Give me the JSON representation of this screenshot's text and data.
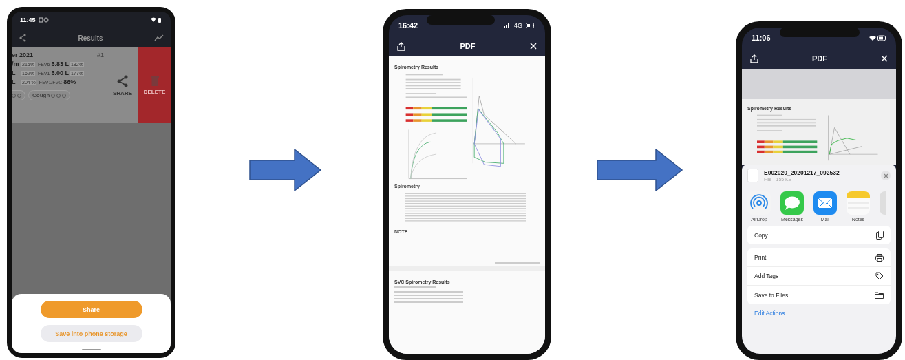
{
  "results_screen": {
    "status_time": "11:45",
    "title": "Results",
    "card": {
      "date": "er 2021",
      "number": "#1",
      "rows": [
        {
          "left_value": "/m",
          "left_percent": "215%",
          "label": "FEV6",
          "value": "5.83 L",
          "percent": "182%"
        },
        {
          "left_value": "L",
          "left_percent": "162%",
          "label": "FEV1",
          "value": "5.00 L",
          "percent": "177%"
        },
        {
          "left_value": "L",
          "left_percent": "204 %",
          "label": "FEV1/FVC",
          "value": "86%"
        }
      ],
      "chips": [
        {
          "kind": "partial"
        },
        {
          "kind": "full",
          "label": "Cough"
        }
      ]
    },
    "swipe_actions": [
      {
        "kind": "share",
        "label": "SHARE"
      },
      {
        "kind": "delete",
        "label": "DELETE"
      }
    ],
    "sheet_buttons": [
      {
        "kind": "primary",
        "label": "Share"
      },
      {
        "kind": "secondary",
        "label": "Save into phone storage"
      }
    ]
  },
  "pdf_screen": {
    "status_time": "16:42",
    "network": "4G",
    "title": "PDF",
    "report_title": "Spirometry Results",
    "section": "Spirometry",
    "note_label": "NOTE",
    "page2_title": "SVC Spirometry Results"
  },
  "share_screen": {
    "status_time": "11:06",
    "title": "PDF",
    "report_title": "Spirometry Results",
    "file_name": "E002020_20201217_092532",
    "file_info": "File · 155 KB",
    "apps": [
      {
        "kind": "airdrop",
        "label": "AirDrop"
      },
      {
        "kind": "messages",
        "label": "Messages"
      },
      {
        "kind": "mail",
        "label": "Mail"
      },
      {
        "kind": "notes",
        "label": "Notes"
      }
    ],
    "action_groups": [
      [
        {
          "kind": "copy",
          "label": "Copy"
        }
      ],
      [
        {
          "kind": "print",
          "label": "Print"
        },
        {
          "kind": "tags",
          "label": "Add Tags"
        },
        {
          "kind": "files",
          "label": "Save to Files"
        }
      ]
    ],
    "edit_actions": "Edit Actions…"
  }
}
